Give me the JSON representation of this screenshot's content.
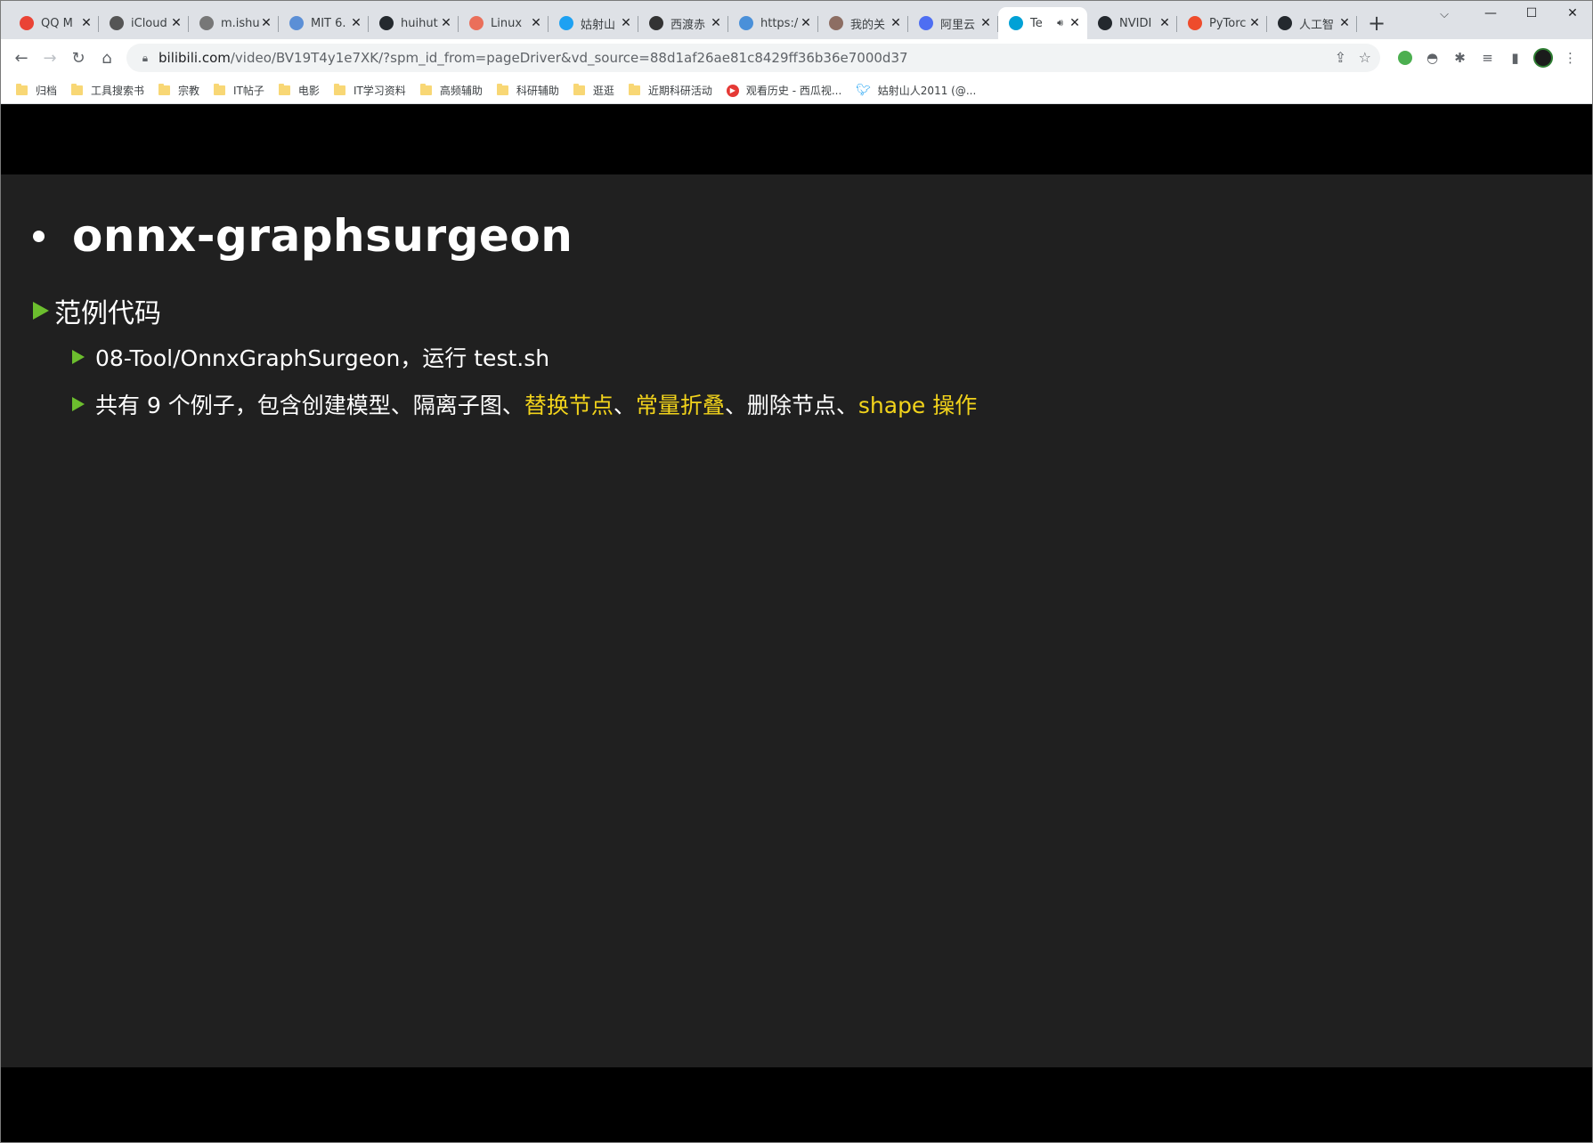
{
  "browser": {
    "tabs": [
      {
        "label": "QQ M",
        "icon": "google-chrome-icon",
        "color": "#ea4335"
      },
      {
        "label": "iCloud",
        "icon": "apple-icon",
        "color": "#555555"
      },
      {
        "label": "m.ishu",
        "icon": "globe-icon",
        "color": "#777777"
      },
      {
        "label": "MIT 6.",
        "icon": "cube-icon",
        "color": "#5b8fd6"
      },
      {
        "label": "huihut",
        "icon": "github-icon",
        "color": "#24292e"
      },
      {
        "label": "Linux",
        "icon": "jianshu-icon",
        "color": "#ea6f5a"
      },
      {
        "label": "姑射山",
        "icon": "twitter-icon",
        "color": "#1da1f2"
      },
      {
        "label": "西渡赤",
        "icon": "wikipedia-icon",
        "color": "#333333"
      },
      {
        "label": "https:/",
        "icon": "wave-icon",
        "color": "#4a90d9"
      },
      {
        "label": "我的关",
        "icon": "pen-icon",
        "color": "#8d6e63"
      },
      {
        "label": "阿里云",
        "icon": "aliyun-icon",
        "color": "#4e6ef2"
      },
      {
        "label": "Te",
        "icon": "bilibili-icon",
        "color": "#00a1d6",
        "active": true,
        "audio": true
      },
      {
        "label": "NVIDI",
        "icon": "github-icon",
        "color": "#24292e"
      },
      {
        "label": "PyTorc",
        "icon": "pytorch-icon",
        "color": "#ee4c2c"
      },
      {
        "label": "人工智",
        "icon": "github-icon",
        "color": "#24292e"
      }
    ],
    "new_tab": "+",
    "url_host": "bilibili.com",
    "url_path": "/video/BV19T4y1e7XK/?spm_id_from=pageDriver&vd_source=88d1af26ae81c8429ff36b36e7000d37",
    "bookmarks": [
      {
        "label": "归档",
        "type": "folder"
      },
      {
        "label": "工具搜索书",
        "type": "folder"
      },
      {
        "label": "宗教",
        "type": "folder"
      },
      {
        "label": "IT帖子",
        "type": "folder"
      },
      {
        "label": "电影",
        "type": "folder"
      },
      {
        "label": "IT学习资料",
        "type": "folder"
      },
      {
        "label": "高频辅助",
        "type": "folder"
      },
      {
        "label": "科研辅助",
        "type": "folder"
      },
      {
        "label": "逛逛",
        "type": "folder"
      },
      {
        "label": "近期科研活动",
        "type": "folder"
      },
      {
        "label": "观看历史 - 西瓜视...",
        "type": "xigua"
      },
      {
        "label": "姑射山人2011 (@...",
        "type": "twitter"
      }
    ]
  },
  "slide": {
    "title": "onnx-graphsurgeon",
    "section": "范例代码",
    "line1": "08-Tool/OnnxGraphSurgeon，运行 test.sh",
    "line2_parts": [
      {
        "text": "共有 9 个例子，包含创建模型、隔离子图、",
        "hl": false
      },
      {
        "text": "替换节点",
        "hl": true
      },
      {
        "text": "、",
        "hl": false
      },
      {
        "text": "常量折叠",
        "hl": true
      },
      {
        "text": "、删除节点、",
        "hl": false
      },
      {
        "text": "shape 操作",
        "hl": true
      }
    ]
  },
  "colors": {
    "slide_bg": "#202020",
    "accent_arrow": "#6cbe2e",
    "highlight": "#f2d31b"
  }
}
